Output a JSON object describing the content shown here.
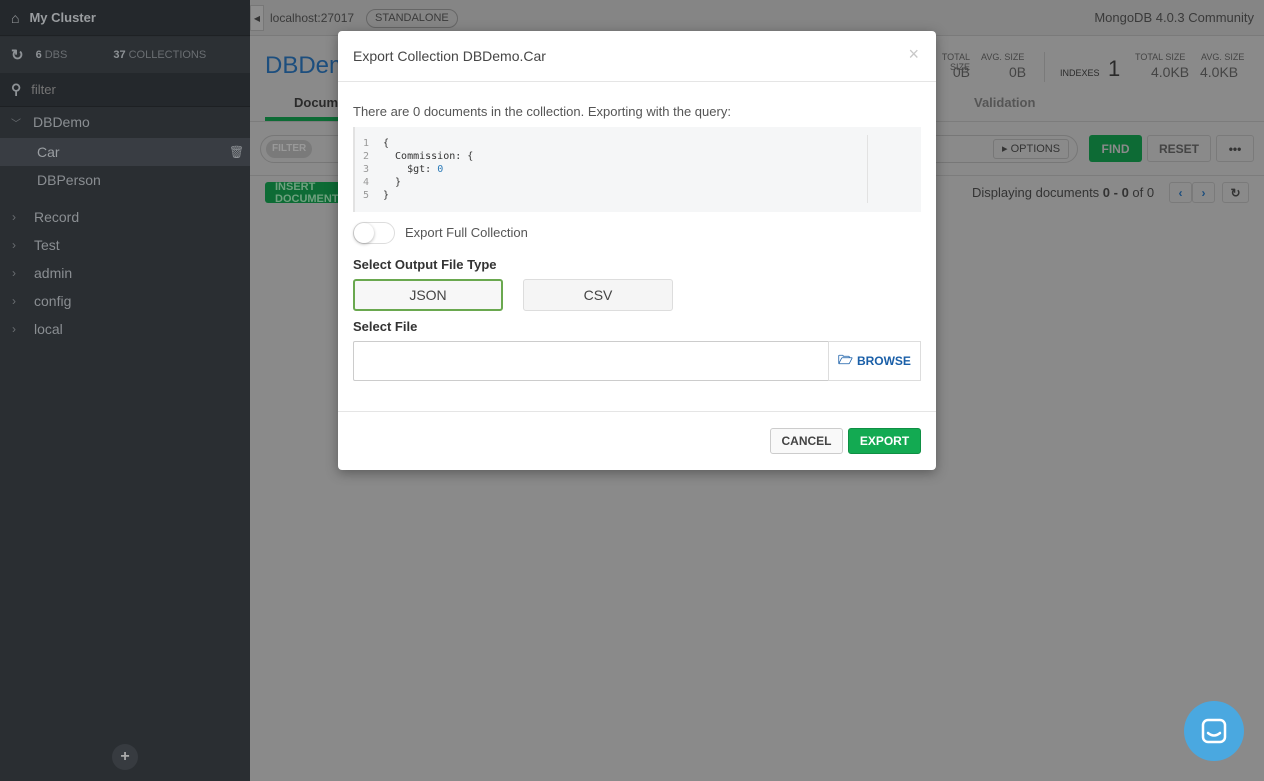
{
  "sidebar": {
    "cluster_name": "My Cluster",
    "dbs_count": "6",
    "dbs_label": "DBS",
    "collections_count": "37",
    "collections_label": "COLLECTIONS",
    "filter_placeholder": "filter",
    "databases": [
      {
        "name": "DBDemo",
        "expanded": true,
        "collections": [
          "Car",
          "DBPerson"
        ]
      },
      {
        "name": "Record"
      },
      {
        "name": "Test"
      },
      {
        "name": "admin"
      },
      {
        "name": "config"
      },
      {
        "name": "local"
      }
    ],
    "selected_collection": "Car",
    "add_label": "+"
  },
  "topbar": {
    "host": "localhost:27017",
    "topology": "STANDALONE",
    "version": "MongoDB 4.0.3 Community"
  },
  "collection": {
    "title": "DBDemo",
    "stats": {
      "total_size_label": "TOTAL SIZE",
      "total_size": "0B",
      "avg_size_label": "AVG. SIZE",
      "avg_size": "0B",
      "indexes_label": "INDEXES",
      "indexes": "1",
      "idx_total_size_label": "TOTAL SIZE",
      "idx_total_size": "4.0KB",
      "idx_avg_size_label": "AVG. SIZE",
      "idx_avg_size": "4.0KB"
    },
    "tabs": [
      "Documents",
      "Validation"
    ],
    "filter_label": "FILTER",
    "options_label": "OPTIONS",
    "find_label": "FIND",
    "reset_label": "RESET",
    "more_label": "•••",
    "insert_label": "INSERT DOCUMENT",
    "display_prefix": "Displaying documents ",
    "display_range": "0 - 0",
    "display_suffix": " of 0"
  },
  "modal": {
    "title": "Export Collection DBDemo.Car",
    "close": "×",
    "description": "There are 0 documents in the collection. Exporting with the query:",
    "query_lines": [
      {
        "n": "1",
        "text": "{"
      },
      {
        "n": "2",
        "text": "  Commission: {"
      },
      {
        "n": "3",
        "text": "    $gt: ",
        "num": "0"
      },
      {
        "n": "4",
        "text": "  }"
      },
      {
        "n": "5",
        "text": "}"
      }
    ],
    "toggle_label": "Export Full Collection",
    "toggle_on": false,
    "file_type_label": "Select Output File Type",
    "file_types": [
      "JSON",
      "CSV"
    ],
    "selected_type": "JSON",
    "file_label": "Select File",
    "file_value": "",
    "browse_label": "BROWSE",
    "cancel_label": "CANCEL",
    "export_label": "EXPORT"
  },
  "colors": {
    "accent": "#13aa52",
    "link": "#1a5fa8",
    "chat": "#4aa8e0"
  }
}
